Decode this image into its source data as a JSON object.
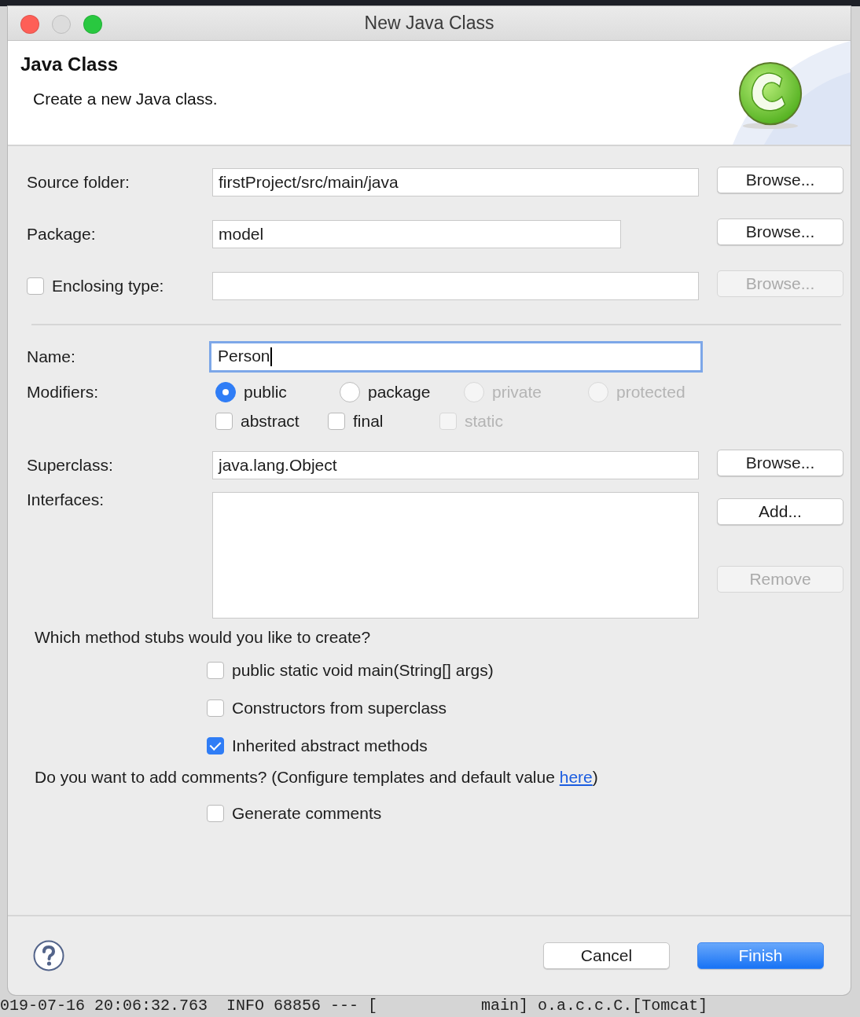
{
  "window": {
    "title": "New Java Class",
    "traffic_lights": [
      {
        "kind": "close",
        "disabled": false
      },
      {
        "kind": "minimize",
        "disabled": true
      },
      {
        "kind": "zoom",
        "disabled": false
      }
    ]
  },
  "header": {
    "title": "Java Class",
    "description": "Create a new Java class."
  },
  "location_fields": [
    {
      "kind": "folder",
      "label": "Source folder:",
      "value": "firstProject/src/main/java",
      "button": {
        "label": "Browse...",
        "disabled": false
      }
    },
    {
      "kind": "package",
      "label": "Package:",
      "value": "model",
      "button": {
        "label": "Browse...",
        "disabled": false
      }
    },
    {
      "kind": "enclosing",
      "label": "Enclosing type:",
      "checked": false,
      "button": {
        "label": "Browse...",
        "disabled": true
      }
    }
  ],
  "name": {
    "label": "Name:",
    "value": "Person",
    "focused": true
  },
  "modifiers": {
    "label": "Modifiers:",
    "access": [
      {
        "label": "public",
        "selected": true,
        "disabled": false
      },
      {
        "label": "package",
        "selected": false,
        "disabled": false
      },
      {
        "label": "private",
        "selected": false,
        "disabled": true
      },
      {
        "label": "protected",
        "selected": false,
        "disabled": true
      }
    ],
    "flags": [
      {
        "label": "abstract",
        "checked": false,
        "disabled": false
      },
      {
        "label": "final",
        "checked": false,
        "disabled": false
      },
      {
        "label": "static",
        "checked": false,
        "disabled": true
      }
    ]
  },
  "superclass": {
    "label": "Superclass:",
    "value": "java.lang.Object",
    "button": {
      "label": "Browse...",
      "disabled": false
    }
  },
  "interfaces": {
    "label": "Interfaces:",
    "buttons": [
      {
        "label": "Add...",
        "disabled": false
      },
      {
        "label": "Remove",
        "disabled": true
      }
    ]
  },
  "stubs": {
    "question": "Which method stubs would you like to create?",
    "options": [
      {
        "label": "public static void main(String[] args)",
        "checked": false
      },
      {
        "label": "Constructors from superclass",
        "checked": false
      },
      {
        "label": "Inherited abstract methods",
        "checked": true
      }
    ]
  },
  "comments": {
    "question": "Do you want to add comments? (Configure templates and default value ",
    "link": "here",
    "question_end": ")",
    "options": [
      {
        "label": "Generate comments",
        "checked": false
      }
    ]
  },
  "footer": {
    "buttons": [
      {
        "label": "Cancel",
        "default": false
      },
      {
        "label": "Finish",
        "default": true
      }
    ]
  },
  "background_log": "019-07-16 20:06:32.763  INFO 68856 --- [           main] o.a.c.c.C.[Tomcat]"
}
